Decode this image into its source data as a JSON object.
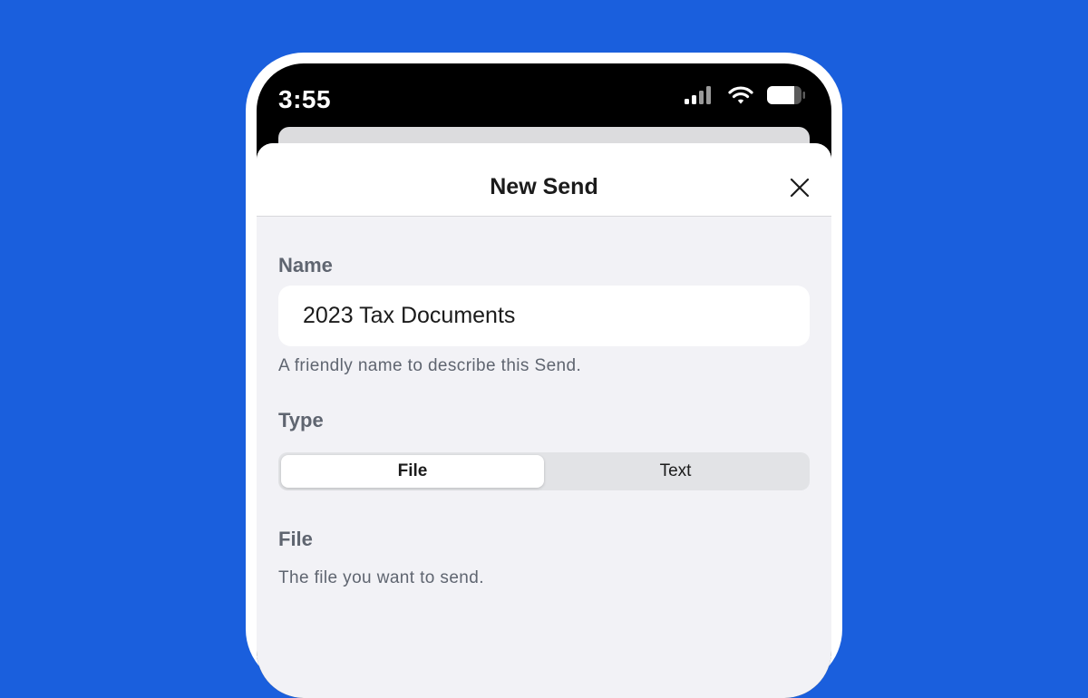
{
  "status_bar": {
    "time": "3:55"
  },
  "sheet": {
    "title": "New Send",
    "close_icon": "close-icon"
  },
  "name_section": {
    "label": "Name",
    "value": "2023 Tax Documents",
    "helper": "A friendly name to describe this Send."
  },
  "type_section": {
    "label": "Type",
    "options": [
      "File",
      "Text"
    ],
    "selected": "File"
  },
  "file_section": {
    "label": "File",
    "helper": "The file you want to send."
  },
  "colors": {
    "background": "#1a5fdd",
    "sheet_background": "#f2f2f6",
    "label_gray": "#5f6570"
  }
}
